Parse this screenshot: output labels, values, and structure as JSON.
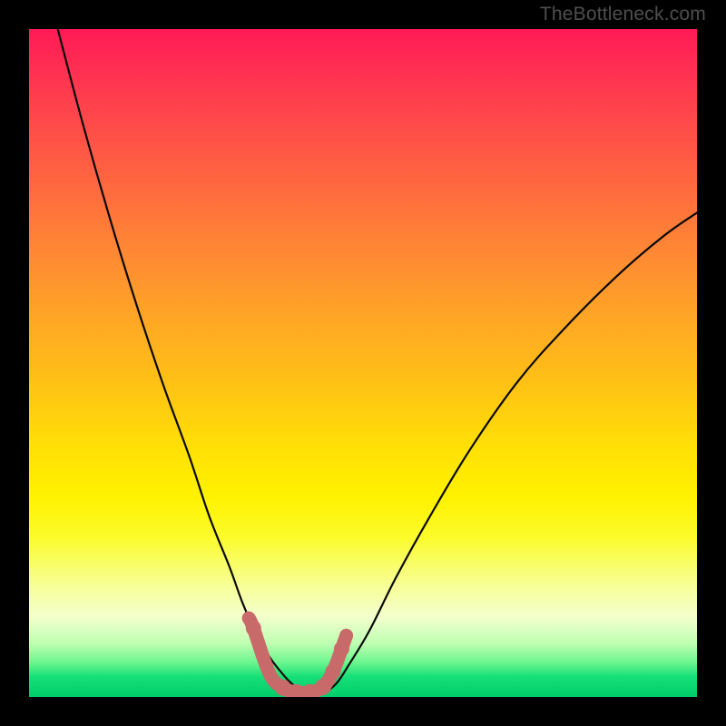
{
  "watermark": "TheBottleneck.com",
  "chart_data": {
    "type": "line",
    "title": "",
    "xlabel": "",
    "ylabel": "",
    "xlim": [
      0,
      100
    ],
    "ylim": [
      0,
      100
    ],
    "series": [
      {
        "name": "left-curve",
        "x": [
          4.3,
          8,
          12,
          16,
          20,
          24,
          27,
          30,
          32,
          34,
          36,
          37.5,
          39,
          40.5,
          42
        ],
        "values": [
          100,
          86,
          72,
          59,
          47,
          36,
          27,
          19.5,
          14,
          9.5,
          6,
          4,
          2.3,
          1.1,
          0.5
        ]
      },
      {
        "name": "right-curve",
        "x": [
          44,
          46,
          48,
          51,
          55,
          60,
          66,
          73,
          80,
          88,
          95,
          100
        ],
        "values": [
          0.5,
          2,
          5,
          10,
          18,
          27,
          37,
          47,
          55,
          63,
          69,
          72.5
        ]
      },
      {
        "name": "bead-cluster",
        "x": [
          32.9,
          33.6,
          36,
          38,
          40,
          42,
          44,
          45.5,
          46.8,
          47.5
        ],
        "values": [
          11.8,
          10.3,
          3.5,
          1.4,
          0.7,
          0.7,
          1.5,
          3.8,
          7.2,
          9.2
        ]
      }
    ],
    "colors": {
      "curve_stroke": "#0a0a0a",
      "bead_fill": "#c96a6a",
      "bead_stroke": "#b85a5a"
    }
  }
}
